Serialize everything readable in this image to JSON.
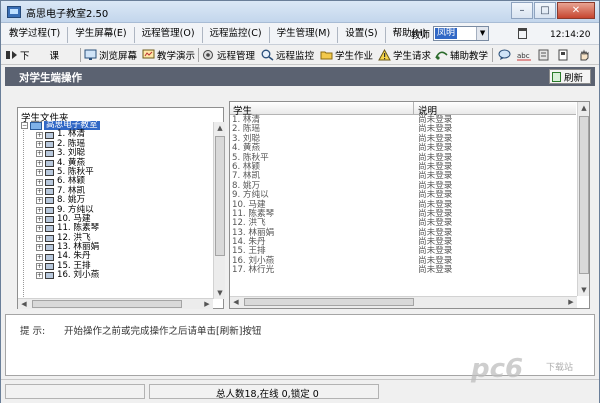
{
  "window": {
    "title": "高思电子教室2.50"
  },
  "menu": {
    "items": [
      "教学过程(T)",
      "学生屏幕(E)",
      "远程管理(O)",
      "远程监控(C)",
      "学生管理(M)",
      "设置(S)",
      "帮助(H)"
    ],
    "teacher_label": "教师",
    "teacher_value": "凤明",
    "time": "12:14:20"
  },
  "toolbar": {
    "items": [
      "下",
      "课",
      "浏览屏幕",
      "教学演示",
      "远程管理",
      "远程监控",
      "学生作业",
      "学生请求",
      "辅助教学"
    ]
  },
  "section": {
    "title": "对学生端操作",
    "refresh_label": "刷新"
  },
  "folder_panel": {
    "header": "学生文件夹",
    "root": "高思电子教室",
    "students": [
      "1. 林清",
      "2. 陈瑶",
      "3. 刘聪",
      "4. 黄燕",
      "5. 陈秋平",
      "6. 林颖",
      "7. 林凯",
      "8. 姚万",
      "9. 方纯以",
      "10. 马建",
      "11. 陈素琴",
      "12. 洪飞",
      "13. 林丽娟",
      "14. 朱丹",
      "15. 王排",
      "16. 刘小燕"
    ]
  },
  "student_list": {
    "columns": [
      "学生",
      "说明"
    ],
    "rows": [
      {
        "name": "1. 林清",
        "status": "尚未登录"
      },
      {
        "name": "2. 陈瑶",
        "status": "尚未登录"
      },
      {
        "name": "3. 刘聪",
        "status": "尚未登录"
      },
      {
        "name": "4. 黄燕",
        "status": "尚未登录"
      },
      {
        "name": "5. 陈秋平",
        "status": "尚未登录"
      },
      {
        "name": "6. 林颖",
        "status": "尚未登录"
      },
      {
        "name": "7. 林凯",
        "status": "尚未登录"
      },
      {
        "name": "8. 姚万",
        "status": "尚未登录"
      },
      {
        "name": "9. 方纯以",
        "status": "尚未登录"
      },
      {
        "name": "10. 马建",
        "status": "尚未登录"
      },
      {
        "name": "11. 陈素琴",
        "status": "尚未登录"
      },
      {
        "name": "12. 洪飞",
        "status": "尚未登录"
      },
      {
        "name": "13. 林丽娟",
        "status": "尚未登录"
      },
      {
        "name": "14. 朱丹",
        "status": "尚未登录"
      },
      {
        "name": "15. 王排",
        "status": "尚未登录"
      },
      {
        "name": "16. 刘小燕",
        "status": "尚未登录"
      },
      {
        "name": "17. 林行光",
        "status": "尚未登录"
      }
    ]
  },
  "hint": {
    "label": "提    示:",
    "text": "开始操作之前或完成操作之后请单击[刷新]按钮"
  },
  "status": {
    "text": "总人数18,在线 0,锁定 0"
  },
  "watermark": {
    "text": "pc6",
    "sub": "下载站"
  }
}
